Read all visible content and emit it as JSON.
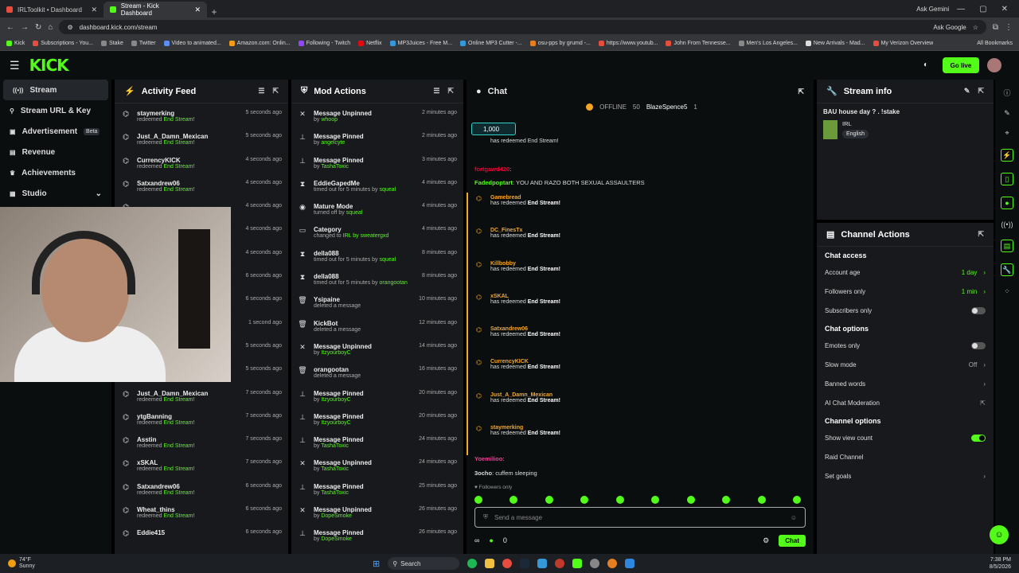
{
  "browser": {
    "tabs": [
      {
        "label": "IRLToolkit • Dashboard",
        "color": "#e74c3c"
      },
      {
        "label": "Stream - Kick Dashboard",
        "color": "#53fc18"
      }
    ],
    "ask_gemini": "Ask Gemini",
    "url": "dashboard.kick.com/stream",
    "ask_google": "Ask Google",
    "bookmarks": [
      {
        "label": "Kick",
        "color": "#53fc18"
      },
      {
        "label": "Subscriptions - You...",
        "color": "#e74c3c"
      },
      {
        "label": "Stake",
        "color": "#888"
      },
      {
        "label": "Twitter",
        "color": "#888"
      },
      {
        "label": "Video to animated...",
        "color": "#5b8ef0"
      },
      {
        "label": "Amazon.com: Onlin...",
        "color": "#f39c12"
      },
      {
        "label": "Following - Twitch",
        "color": "#9146ff"
      },
      {
        "label": "Netflix",
        "color": "#e50914"
      },
      {
        "label": "MP3Juices - Free M...",
        "color": "#3498db"
      },
      {
        "label": "Online MP3 Cutter -...",
        "color": "#3498db"
      },
      {
        "label": "osu-pps by grumd -...",
        "color": "#e67e22"
      },
      {
        "label": "https://www.youtub...",
        "color": "#e74c3c"
      },
      {
        "label": "John From Tennesse...",
        "color": "#e74c3c"
      },
      {
        "label": "Men's Los Angeles...",
        "color": "#888"
      },
      {
        "label": "New Arrivals - Mad...",
        "color": "#ddd"
      },
      {
        "label": "My Verizon Overview",
        "color": "#e74c3c"
      }
    ],
    "all_bookmarks": "All Bookmarks"
  },
  "header": {
    "logo": "KICK",
    "go_live": "Go live"
  },
  "sidenav": [
    {
      "label": "Stream",
      "icon": "stream-icon",
      "glyph": "((•))"
    },
    {
      "label": "Stream URL & Key",
      "icon": "link-icon",
      "glyph": "⚲"
    },
    {
      "label": "Advertisement",
      "icon": "ad-icon",
      "glyph": "▣",
      "badge": "Beta"
    },
    {
      "label": "Revenue",
      "icon": "revenue-icon",
      "glyph": "▤"
    },
    {
      "label": "Achievements",
      "icon": "trophy-icon",
      "glyph": "♛"
    },
    {
      "label": "Studio",
      "icon": "studio-icon",
      "glyph": "▦"
    }
  ],
  "activity_feed": {
    "title": "Activity Feed",
    "items": [
      {
        "name": "staymerking",
        "pre": "redeemed",
        "hl": "End Stream!",
        "time": "5 seconds ago"
      },
      {
        "name": "Just_A_Damn_Mexican",
        "pre": "redeemed",
        "hl": "End Stream!",
        "time": "5 seconds ago"
      },
      {
        "name": "CurrencyKICK",
        "pre": "redeemed",
        "hl": "End Stream!",
        "time": "4 seconds ago"
      },
      {
        "name": "Satxandrew06",
        "pre": "redeemed",
        "hl": "End Stream!",
        "time": "4 seconds ago"
      },
      {
        "name": "",
        "pre": "",
        "hl": "",
        "time": "4 seconds ago"
      },
      {
        "name": "",
        "pre": "",
        "hl": "",
        "time": "4 seconds ago"
      },
      {
        "name": "",
        "pre": "",
        "hl": "",
        "time": "4 seconds ago"
      },
      {
        "name": "",
        "pre": "",
        "hl": "",
        "time": "6 seconds ago"
      },
      {
        "name": "",
        "pre": "",
        "hl": "",
        "time": "6 seconds ago"
      },
      {
        "name": "",
        "pre": "",
        "hl": "",
        "time": "1 second ago"
      },
      {
        "name": "",
        "pre": "",
        "hl": "",
        "time": "5 seconds ago"
      },
      {
        "name": "",
        "pre": "redeemed",
        "hl": "End Stream!",
        "time": "5 seconds ago"
      },
      {
        "name": "Just_A_Damn_Mexican",
        "pre": "redeemed",
        "hl": "End Stream!",
        "time": "7 seconds ago"
      },
      {
        "name": "ytgBanning",
        "pre": "redeemed",
        "hl": "End Stream!",
        "time": "7 seconds ago"
      },
      {
        "name": "Asstin",
        "pre": "redeemed",
        "hl": "End Stream!",
        "time": "7 seconds ago"
      },
      {
        "name": "xSKAL",
        "pre": "redeemed",
        "hl": "End Stream!",
        "time": "7 seconds ago"
      },
      {
        "name": "Satxandrew06",
        "pre": "redeemed",
        "hl": "End Stream!",
        "time": "6 seconds ago"
      },
      {
        "name": "Wheat_thins",
        "pre": "redeemed",
        "hl": "End Stream!",
        "time": "6 seconds ago"
      },
      {
        "name": "Eddie415",
        "pre": "",
        "hl": "",
        "time": "6 seconds ago"
      }
    ]
  },
  "mod_actions": {
    "title": "Mod Actions",
    "items": [
      {
        "icon": "unpin-icon",
        "glyph": "✕",
        "name": "Message Unpinned",
        "pre": "by",
        "hl": "whoop",
        "time": "2 minutes ago"
      },
      {
        "icon": "pin-icon",
        "glyph": "⊥",
        "name": "Message Pinned",
        "pre": "by",
        "hl": "angelcyte",
        "time": "2 minutes ago"
      },
      {
        "icon": "pin-icon",
        "glyph": "⊥",
        "name": "Message Pinned",
        "pre": "by",
        "hl": "TashaToxic",
        "time": "3 minutes ago"
      },
      {
        "icon": "timeout-icon",
        "glyph": "⧗",
        "name": "EddieGapedMe",
        "pre": "timed out for 5 minutes by",
        "hl": "squeal",
        "time": "4 minutes ago"
      },
      {
        "icon": "eye-icon",
        "glyph": "◉",
        "name": "Mature Mode",
        "pre": "turned off by",
        "hl": "squeal",
        "time": "4 minutes ago"
      },
      {
        "icon": "category-icon",
        "glyph": "▭",
        "name": "Category",
        "pre": "changed to",
        "hl": "IRL by sweatergxd",
        "time": "4 minutes ago"
      },
      {
        "icon": "timeout-icon",
        "glyph": "⧗",
        "name": "della088",
        "pre": "timed out for 5 minutes by",
        "hl": "squeal",
        "time": "8 minutes ago"
      },
      {
        "icon": "timeout-icon",
        "glyph": "⧗",
        "name": "della088",
        "pre": "timed out for 5 minutes by",
        "hl": "orangootan",
        "time": "8 minutes ago"
      },
      {
        "icon": "trash-icon",
        "glyph": "🗑",
        "name": "Ysipaine",
        "pre": "deleted a message",
        "hl": "",
        "time": "10 minutes ago"
      },
      {
        "icon": "trash-icon",
        "glyph": "🗑",
        "name": "KickBot",
        "pre": "deleted a message",
        "hl": "",
        "time": "12 minutes ago"
      },
      {
        "icon": "unpin-icon",
        "glyph": "✕",
        "name": "Message Unpinned",
        "pre": "by",
        "hl": "ItzyourboyC",
        "time": "14 minutes ago"
      },
      {
        "icon": "trash-icon",
        "glyph": "🗑",
        "name": "orangootan",
        "pre": "deleted a message",
        "hl": "",
        "time": "16 minutes ago"
      },
      {
        "icon": "pin-icon",
        "glyph": "⊥",
        "name": "Message Pinned",
        "pre": "by",
        "hl": "ItzyourboyC",
        "time": "20 minutes ago"
      },
      {
        "icon": "pin-icon",
        "glyph": "⊥",
        "name": "Message Pinned",
        "pre": "by",
        "hl": "ItzyourboyC",
        "time": "20 minutes ago"
      },
      {
        "icon": "pin-icon",
        "glyph": "⊥",
        "name": "Message Pinned",
        "pre": "by",
        "hl": "TashaToxic",
        "time": "24 minutes ago"
      },
      {
        "icon": "unpin-icon",
        "glyph": "✕",
        "name": "Message Unpinned",
        "pre": "by",
        "hl": "TashaToxic",
        "time": "24 minutes ago"
      },
      {
        "icon": "pin-icon",
        "glyph": "⊥",
        "name": "Message Pinned",
        "pre": "by",
        "hl": "TashaToxic",
        "time": "25 minutes ago"
      },
      {
        "icon": "unpin-icon",
        "glyph": "✕",
        "name": "Message Unpinned",
        "pre": "by",
        "hl": "DopeSmoke",
        "time": "26 minutes ago"
      },
      {
        "icon": "pin-icon",
        "glyph": "⊥",
        "name": "Message Pinned",
        "pre": "by",
        "hl": "DopeSmoke",
        "time": "26 minutes ago"
      }
    ]
  },
  "chat": {
    "title": "Chat",
    "status": "OFFLINE",
    "viewers": "50",
    "moderator": "BlazeSpence5",
    "mod_count": "1",
    "goal": "1,000",
    "top_msg": "has redeemed End Stream!",
    "line1_user": "fortgawd420",
    "line2_user": "Fadedpoptart",
    "line2_text": "YOU AND RAZO BOTH SEXUAL ASSAULTERS",
    "redeems": [
      "Gamebread",
      "DC_FinesTx",
      "Killbobby",
      "xSKAL",
      "Satxandrew06",
      "CurrencyKICK",
      "Just_A_Damn_Mexican",
      "staymerking"
    ],
    "redeem_text": "has redeemed",
    "redeem_reward": "End Stream!",
    "line3_user": "Yoemilioo",
    "line4_user": "3ocho",
    "line4_text": "cuffem sleeping",
    "followers_only": "Followers only",
    "placeholder": "Send a message",
    "count": "0",
    "chat_button": "Chat"
  },
  "stream_info": {
    "title": "Stream info",
    "stream_title": "BAU house day ? . !stake",
    "category": "IRL",
    "language": "English"
  },
  "channel_actions": {
    "title": "Channel Actions",
    "chat_access": "Chat access",
    "account_age": "Account age",
    "account_age_val": "1 day",
    "followers_only": "Followers only",
    "followers_only_val": "1 min",
    "subscribers_only": "Subscribers only",
    "chat_options": "Chat options",
    "emotes_only": "Emotes only",
    "slow_mode": "Slow mode",
    "slow_mode_val": "Off",
    "banned_words": "Banned words",
    "ai_moderation": "AI Chat Moderation",
    "channel_options": "Channel options",
    "show_view_count": "Show view count",
    "raid_channel": "Raid Channel",
    "set_goals": "Set goals"
  },
  "taskbar": {
    "temp": "74°F",
    "weather": "Sunny",
    "search": "Search",
    "time": "7:38 PM",
    "date": "8/5/2026"
  }
}
